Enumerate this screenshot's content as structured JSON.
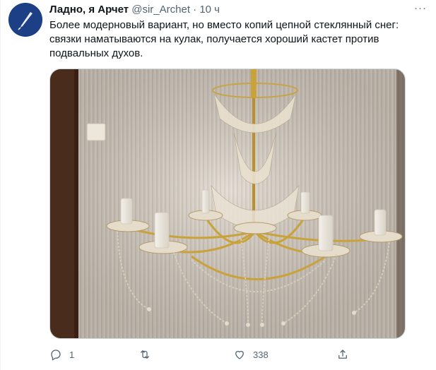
{
  "tweet": {
    "author_name": "Ладно, я Арчет",
    "author_handle": "@sir_Archet",
    "separator": "·",
    "time": "10 ч",
    "more_label": "···",
    "text": "Более модерновый вариант, но вместо копий цепной стеклянный снег: связки наматываются на кулак, получается хороший кастет против подвальных духов."
  },
  "actions": {
    "reply_count": "1",
    "retweet_count": "",
    "like_count": "338"
  },
  "icons": {
    "avatar": "quill-pen-icon",
    "reply": "reply-icon",
    "retweet": "retweet-icon",
    "like": "heart-icon",
    "share": "share-icon"
  },
  "colors": {
    "avatar_bg": "#1c3f86",
    "muted_text": "#536471",
    "primary_text": "#0f1419"
  }
}
